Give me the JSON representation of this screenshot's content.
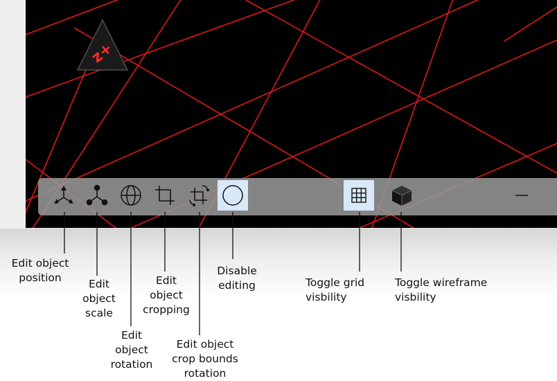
{
  "viewport": {
    "gizmo": {
      "label": "z+",
      "icon": "z-axis-gizmo-icon"
    }
  },
  "toolbar": {
    "buttons": [
      {
        "id": "edit-position",
        "icon": "move-axes-icon",
        "active": false
      },
      {
        "id": "edit-scale",
        "icon": "scale-nodes-icon",
        "active": false
      },
      {
        "id": "edit-rotation",
        "icon": "globe-rotation-icon",
        "active": false
      },
      {
        "id": "edit-cropping",
        "icon": "crop-icon",
        "active": false
      },
      {
        "id": "edit-crop-bounds-rotation",
        "icon": "crop-rotate-icon",
        "active": false
      },
      {
        "id": "disable-editing",
        "icon": "circle-icon",
        "active": true
      },
      {
        "id": "toggle-grid",
        "icon": "grid-icon",
        "active": true
      },
      {
        "id": "toggle-wireframe",
        "icon": "cube-icon",
        "active": false
      },
      {
        "id": "minimize",
        "icon": "minus-icon",
        "active": false
      }
    ]
  },
  "annotations": {
    "edit_position": "Edit object\nposition",
    "edit_scale": "Edit\nobject\nscale",
    "edit_rotation": "Edit\nobject\nrotation",
    "edit_cropping": "Edit\nobject\ncropping",
    "edit_crop_bounds_rotation": "Edit object\ncrop bounds\nrotation",
    "disable_editing": "Disable\nediting",
    "toggle_grid": "Toggle grid\nvisbility",
    "toggle_wireframe": "Toggle wireframe\nvisbility"
  },
  "colors": {
    "grid_line": "#e01818",
    "viewport_bg": "#000000",
    "toolbar_bg": "#969696",
    "active_button": "#d8e8f7",
    "gizmo_text": "#ff2a2a"
  }
}
